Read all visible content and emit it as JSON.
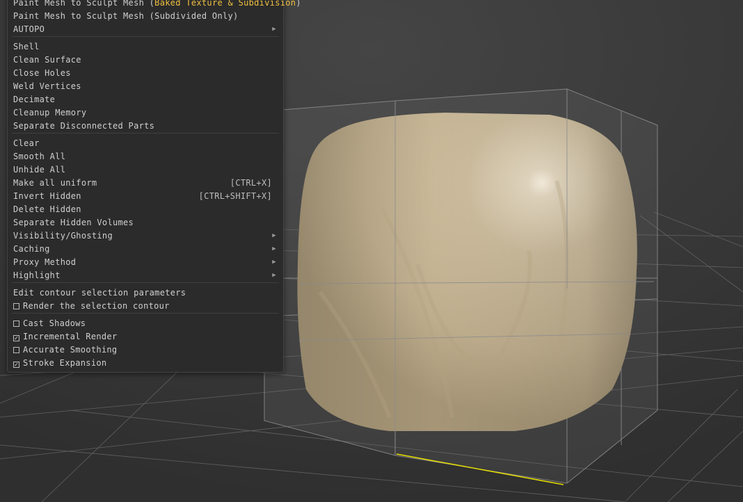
{
  "menu": {
    "items": [
      {
        "label": "Paint Mesh to Sculpt Mesh (",
        "highlight": "Baked Texture & Subdivision",
        "suffix": ")"
      },
      {
        "label": "Paint Mesh to Sculpt Mesh (Subdivided Only)"
      },
      {
        "label": "AUTOPO",
        "submenu": true
      },
      {
        "label": "Shell"
      },
      {
        "label": "Clean Surface"
      },
      {
        "label": "Close Holes"
      },
      {
        "label": "Weld Vertices"
      },
      {
        "label": "Decimate"
      },
      {
        "label": "Cleanup Memory"
      },
      {
        "label": "Separate Disconnected Parts"
      },
      {
        "label": "Clear"
      },
      {
        "label": "Smooth All"
      },
      {
        "label": "Unhide All"
      },
      {
        "label": "Make all uniform",
        "shortcut": "[CTRL+X]"
      },
      {
        "label": "Invert Hidden",
        "shortcut": "[CTRL+SHIFT+X]"
      },
      {
        "label": "Delete Hidden"
      },
      {
        "label": "Separate Hidden Volumes"
      },
      {
        "label": "Visibility/Ghosting",
        "submenu": true
      },
      {
        "label": "Caching",
        "submenu": true
      },
      {
        "label": "Proxy Method",
        "submenu": true
      },
      {
        "label": "Highlight",
        "submenu": true
      },
      {
        "label": "Edit contour selection parameters"
      },
      {
        "label": "Render the selection contour",
        "checkbox": true,
        "checked": false
      },
      {
        "label": "Cast Shadows",
        "checkbox": true,
        "checked": false
      },
      {
        "label": "Incremental Render",
        "checkbox": true,
        "checked": true
      },
      {
        "label": "Accurate Smoothing",
        "checkbox": true,
        "checked": false
      },
      {
        "label": "Stroke Expansion",
        "checkbox": true,
        "checked": true
      }
    ]
  },
  "colors": {
    "menu_bg": "#2b2b2b",
    "menu_text": "#cfcfcf",
    "highlight_text": "#f0c040",
    "viewport_bg": "#3a3a3a",
    "mesh": "#cdbb9c",
    "selection_edge": "#e8e000"
  },
  "icons": {
    "submenu": "chevron-right-icon",
    "check": "checkmark-icon"
  }
}
